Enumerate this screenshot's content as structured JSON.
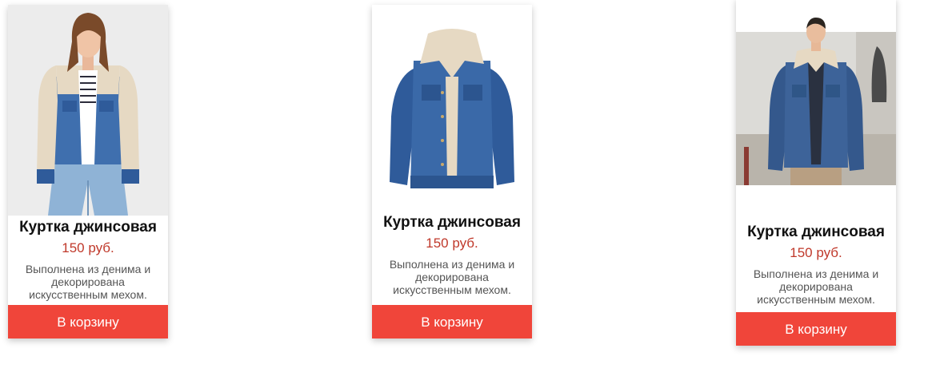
{
  "products": [
    {
      "title": "Куртка джинсовая",
      "price": "150 руб.",
      "description": "Выполнена из денима и декорирована искусственным мехом.",
      "button_label": "В корзину"
    },
    {
      "title": "Куртка джинсовая",
      "price": "150 руб.",
      "description": "Выполнена из денима и декорирована искусственным мехом.",
      "button_label": "В корзину"
    },
    {
      "title": "Куртка джинсовая",
      "price": "150 руб.",
      "description": "Выполнена из денима и декорирована искусственным мехом.",
      "button_label": "В корзину"
    }
  ],
  "colors": {
    "accent": "#f0453a",
    "price": "#c0392b",
    "denim": "#2f5b9a",
    "sherpa": "#e6d9c3"
  }
}
